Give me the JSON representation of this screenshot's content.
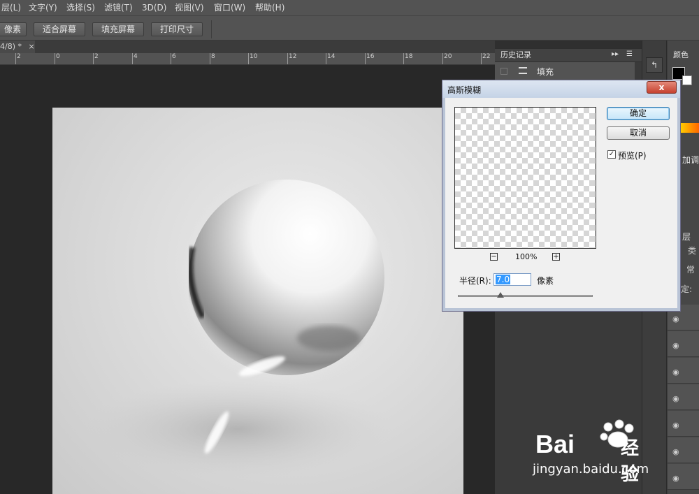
{
  "menu": {
    "items": [
      "层(L)",
      "文字(Y)",
      "选择(S)",
      "滤镜(T)",
      "3D(D)",
      "视图(V)",
      "窗口(W)",
      "帮助(H)"
    ]
  },
  "options": {
    "buttons": [
      "像素",
      "适合屏幕",
      "填充屏幕",
      "打印尺寸"
    ]
  },
  "tab": {
    "label": "4/8) *",
    "close": "×"
  },
  "ruler": {
    "ticks": [
      "2",
      "0",
      "2",
      "4",
      "6",
      "8",
      "10",
      "12",
      "14",
      "16",
      "18",
      "20",
      "22"
    ]
  },
  "history": {
    "title": "历史记录",
    "item": "填充",
    "collapse": "▸▸"
  },
  "right_panel": {
    "color_tab": "颜色",
    "adjust_label": "加调",
    "layer_tab": "层",
    "kind_label": "类",
    "blend_label": "常",
    "lock_label": "定:"
  },
  "dialog": {
    "title": "高斯模糊",
    "close": "x",
    "ok": "确定",
    "cancel": "取消",
    "preview_label": "预览(P)",
    "preview_checked": true,
    "zoom_out": "−",
    "zoom_in": "+",
    "zoom_level": "100%",
    "radius_label": "半径(R):",
    "radius_value": "7.0",
    "radius_unit": "像素"
  },
  "watermark": {
    "brand": "Bai",
    "brand_suffix": "经验",
    "url": "jingyan.baidu.com"
  }
}
